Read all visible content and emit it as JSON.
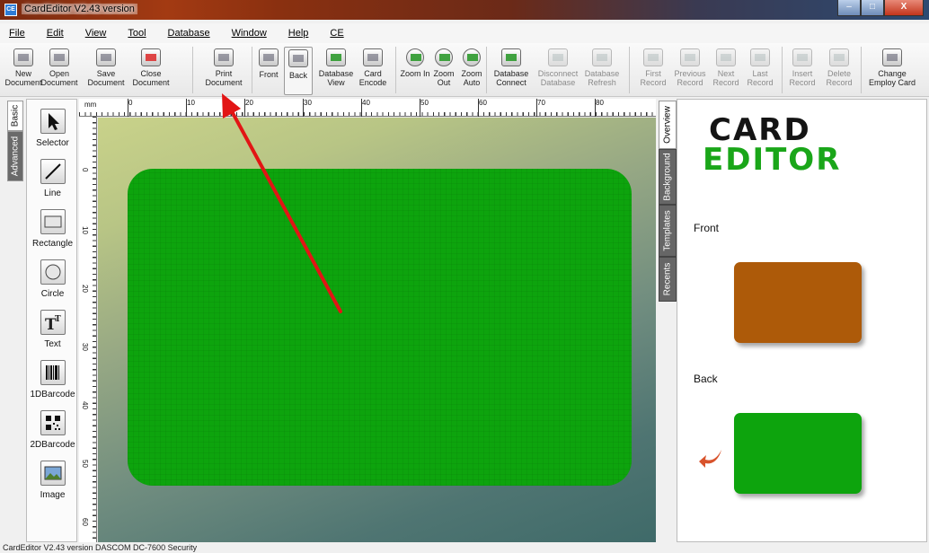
{
  "window": {
    "icon_text": "CE",
    "title": "CardEditor V2.43 version",
    "minimize": "–",
    "maximize": "□",
    "close": "X"
  },
  "menu": [
    "File",
    "Edit",
    "View",
    "Tool",
    "Database",
    "Window",
    "Help",
    "CE"
  ],
  "toolbar": {
    "new_document": "New Document",
    "open_document": "Open Document",
    "save_document": "Save Document",
    "close_document": "Close Document",
    "print_document": "Print Document",
    "front": "Front",
    "back": "Back",
    "database_view": "Database View",
    "card_encode": "Card Encode",
    "zoom_in": "Zoom In",
    "zoom_out": "Zoom Out",
    "zoom_auto": "Zoom Auto",
    "database_connect": "Database Connect",
    "disconnect_database": "Disconnect Database",
    "database_refresh": "Database Refresh",
    "first_record": "First Record",
    "previous_record": "Previous Record",
    "next_record": "Next Record",
    "last_record": "Last Record",
    "insert_record": "Insert Record",
    "delete_record": "Delete Record",
    "change_employ_card": "Change Employ Card"
  },
  "left_tabs": {
    "basic": "Basic",
    "advanced": "Advanced"
  },
  "tools": [
    "Selector",
    "Line",
    "Rectangle",
    "Circle",
    "Text",
    "1DBarcode",
    "2DBarcode",
    "Image"
  ],
  "ruler": {
    "unit": "mm",
    "top_ticks": [
      "0",
      "10",
      "20",
      "30",
      "40",
      "50",
      "60",
      "70",
      "80"
    ],
    "left_ticks": [
      "0",
      "10",
      "20",
      "30",
      "40",
      "50",
      "60"
    ]
  },
  "colors": {
    "card_back": "#0da40d",
    "card_front_thumb": "#ad5a09",
    "card_back_thumb": "#0da40d",
    "logo_green": "#1aa619",
    "annotation_arrow": "#e21515"
  },
  "right_tabs": {
    "overview": "Overview",
    "background": "Background",
    "templates": "Templates",
    "recents": "Recents"
  },
  "overview": {
    "logo_line1": "CARD",
    "logo_line2": "EDITOR",
    "front_label": "Front",
    "back_label": "Back"
  },
  "status": "CardEditor V2.43 version DASCOM DC-7600 Security"
}
